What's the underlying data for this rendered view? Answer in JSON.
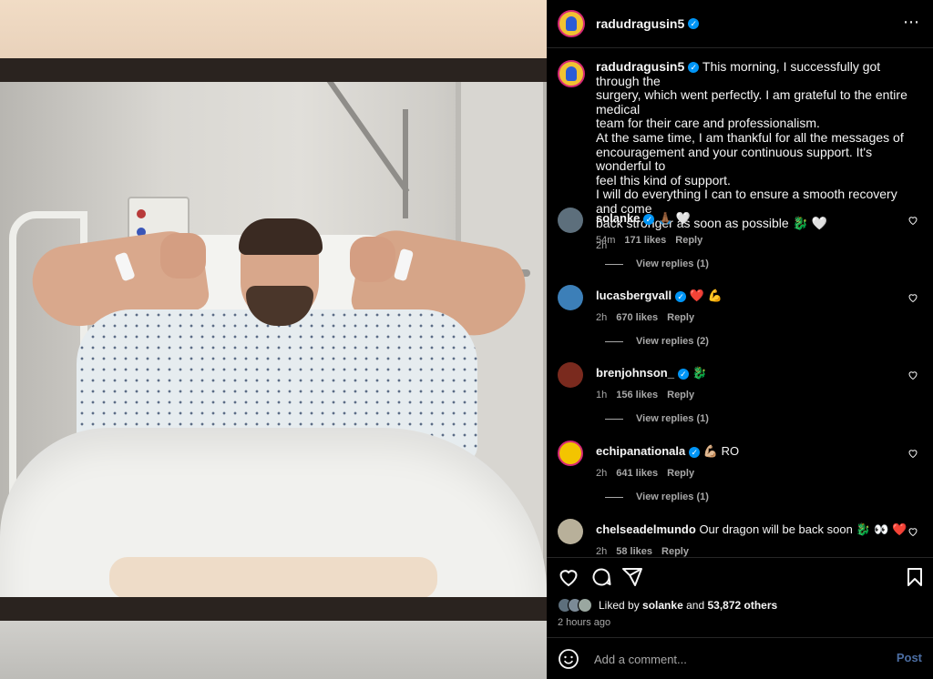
{
  "post": {
    "username": "radudragusin5",
    "verified_mark": "✓",
    "more_icon": "⋯",
    "caption_lines": [
      "This morning, I successfully got through the",
      "surgery, which went perfectly. I am grateful to the entire medical",
      "team for their care and professionalism.",
      "At the same time, I am thankful for all the messages of",
      "encouragement and your continuous support. It's wonderful to",
      "feel this kind of support.",
      "I will do everything I can to ensure a smooth recovery and come",
      "back stronger as soon as possible 🐉 🤍"
    ],
    "caption_time": "2h"
  },
  "comments": [
    {
      "username": "solanke",
      "text": "🙏🏾 🤍",
      "time": "54m",
      "likes": "171 likes",
      "reply": "Reply",
      "view_replies": "View replies (1)",
      "avatar_color": "#5d6f7c"
    },
    {
      "username": "lucasbergvall",
      "text": "❤️ 💪",
      "time": "2h",
      "likes": "670 likes",
      "reply": "Reply",
      "view_replies": "View replies (2)",
      "avatar_color": "#3c7fb8"
    },
    {
      "username": "brenjohnson_",
      "text": "🐉",
      "time": "1h",
      "likes": "156 likes",
      "reply": "Reply",
      "view_replies": "View replies (1)",
      "avatar_color": "#7a2a1e"
    },
    {
      "username": "echipanationala",
      "text": "💪🏼 RO",
      "time": "2h",
      "likes": "641 likes",
      "reply": "Reply",
      "view_replies": "View replies (1)",
      "avatar_color": "#f3c400"
    },
    {
      "username": "chelseadelmundo",
      "text": "Our dragon will be back soon 🐉 👀 ❤️",
      "time": "2h",
      "likes": "58 likes",
      "reply": "Reply",
      "view_replies": "",
      "avatar_color": "#b8b09a"
    }
  ],
  "footer": {
    "liked_prefix": "Liked by",
    "liked_user": "solanke",
    "liked_and": "and",
    "liked_others": "53,872 others",
    "time_ago": "2 hours ago",
    "add_comment_placeholder": "Add a comment...",
    "post_label": "Post"
  },
  "colors": {
    "verified": "#0095f6",
    "post_link": "#4c6ea3",
    "accent_red": "#ed4956"
  }
}
